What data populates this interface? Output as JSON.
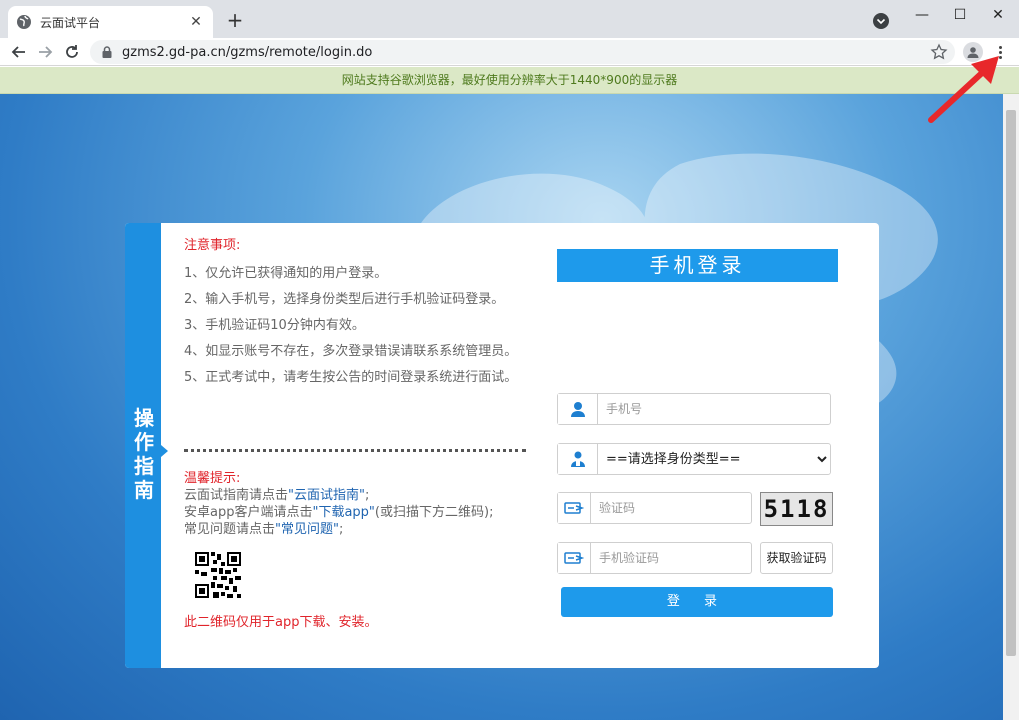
{
  "browser": {
    "tab_title": "云面试平台",
    "url": "gzms2.gd-pa.cn/gzms/remote/login.do"
  },
  "notice_bar": "网站支持谷歌浏览器，最好使用分辨率大于1440*900的显示器",
  "guide_label": "操作指南",
  "notes": {
    "title": "注意事项:",
    "items": [
      "1、仅允许已获得通知的用户登录。",
      "2、输入手机号，选择身份类型后进行手机验证码登录。",
      "3、手机验证码10分钟内有效。",
      "4、如显示账号不存在，多次登录错误请联系系统管理员。",
      "5、正式考试中，请考生按公告的时间登录系统进行面试。"
    ]
  },
  "tips": {
    "title": "温馨提示:",
    "line1_pre": "云面试指南请点击",
    "line1_link": "\"云面试指南\"",
    "line1_post": ";",
    "line2_pre": "安卓app客户端请点击",
    "line2_link": "\"下载app\"",
    "line2_post": "(或扫描下方二维码);",
    "line3_pre": "常见问题请点击",
    "line3_link": "\"常见问题\"",
    "line3_post": ";",
    "qr_note": "此二维码仅用于app下载、安装。"
  },
  "login": {
    "heading": "手机登录",
    "phone_placeholder": "手机号",
    "identity_selected": "==请选择身份类型==",
    "captcha_placeholder": "验证码",
    "captcha_code": "5118",
    "sms_placeholder": "手机验证码",
    "sms_button": "获取验证码",
    "submit": "登 录"
  },
  "colors": {
    "accent": "#1e9aeb",
    "guide_bar": "#1e8fe0",
    "warning": "#e0242b",
    "link": "#1f64b0"
  }
}
